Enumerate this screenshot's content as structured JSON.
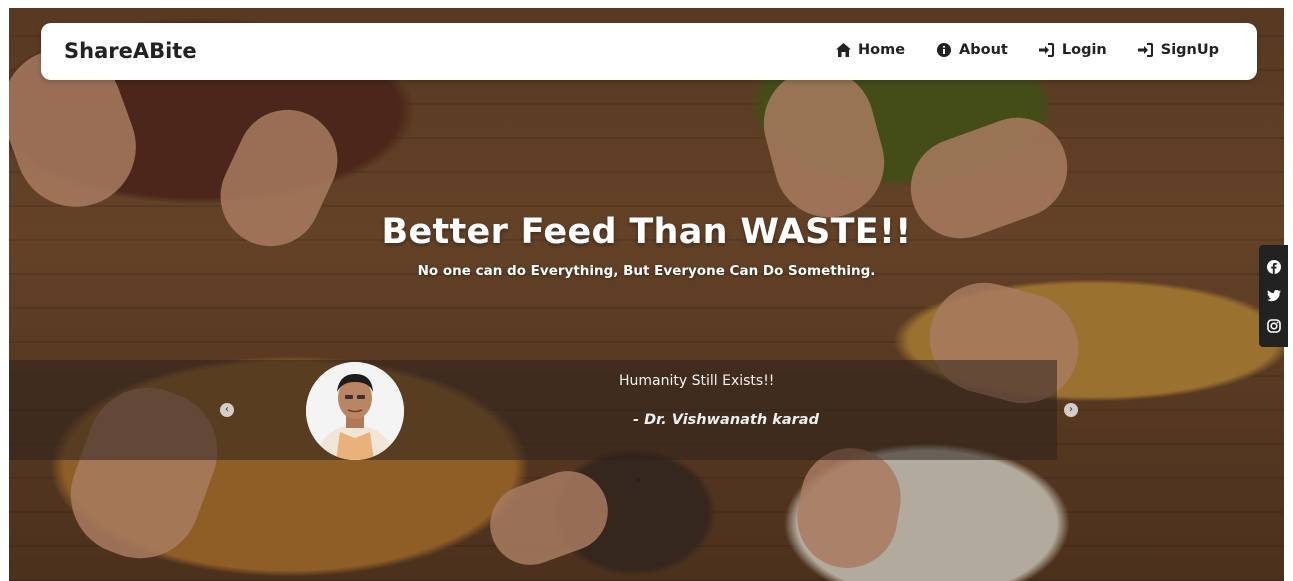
{
  "brand": "ShareABite",
  "nav": [
    {
      "label": "Home",
      "icon": "home-icon"
    },
    {
      "label": "About",
      "icon": "info-icon"
    },
    {
      "label": "Login",
      "icon": "sign-in-icon"
    },
    {
      "label": "SignUp",
      "icon": "sign-in-icon"
    }
  ],
  "hero": {
    "title": "Better Feed Than WASTE!!",
    "subtitle": "No one can do Everything, But Everyone Can Do Something."
  },
  "testimonial": {
    "quote": "Humanity Still Exists!!",
    "author": "- Dr. Vishwanath karad",
    "prev_icon": "chevron-left-icon",
    "next_icon": "chevron-right-icon"
  },
  "social": [
    "facebook-icon",
    "twitter-icon",
    "instagram-icon"
  ],
  "colors": {
    "nav_bg": "#ffffff",
    "text_dark": "#222222",
    "social_bg": "#222222"
  }
}
